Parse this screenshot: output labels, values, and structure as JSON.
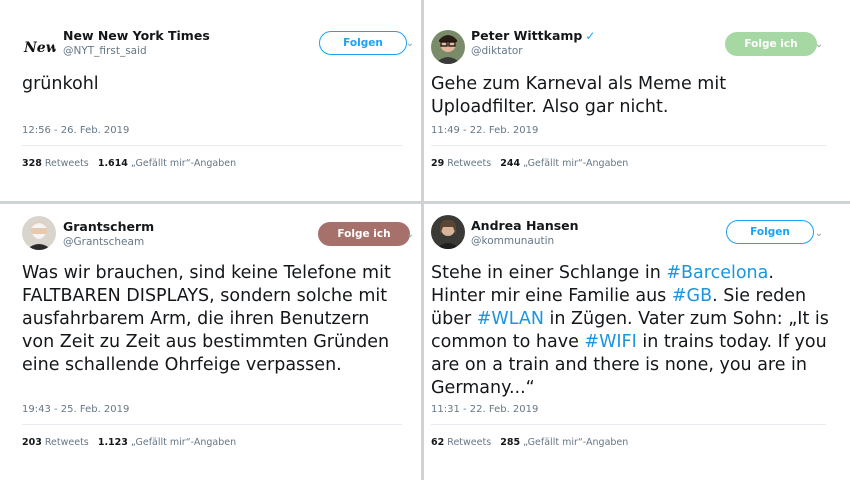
{
  "tweets": [
    {
      "name": "New New York Times",
      "handle": "@NYT_first_said",
      "button": "Folgen",
      "text": "grünkohl",
      "time": "12:56 - 26. Feb. 2019",
      "retweets_count": "328",
      "retweets_label": "Retweets",
      "likes_count": "1.614",
      "likes_label": "„Gefällt mir“-Angaben",
      "avatar_text": "New"
    },
    {
      "name": "Peter Wittkamp",
      "handle": "@diktator",
      "button": "Folge ich",
      "text": "Gehe zum Karneval als Meme mit Uploadfilter. Also gar nicht.",
      "time": "11:49 - 22. Feb. 2019",
      "retweets_count": "29",
      "retweets_label": "Retweets",
      "likes_count": "244",
      "likes_label": "„Gefällt mir“-Angaben"
    },
    {
      "name": "Grantscherm",
      "handle": "@Grantscheam",
      "button": "Folge ich",
      "text": "Was wir brauchen, sind keine Telefone mit FALTBAREN DISPLAYS, sondern solche mit ausfahrbarem Arm, die ihren Benutzern von Zeit zu Zeit aus bestimmten Gründen eine schallende Ohrfeige verpassen.",
      "time": "19:43 - 25. Feb. 2019",
      "retweets_count": "203",
      "retweets_label": "Retweets",
      "likes_count": "1.123",
      "likes_label": "„Gefällt mir“-Angaben"
    },
    {
      "name": "Andrea Hansen",
      "handle": "@kommunautin",
      "button": "Folgen",
      "text_parts": [
        "Stehe in einer Schlange in ",
        "#Barcelona",
        ". Hinter mir eine Familie aus ",
        "#GB",
        ". Sie reden über ",
        "#WLAN",
        " in Zügen. Vater zum Sohn: „It is common to have ",
        "#WIFI",
        " in trains today. If you are on a train and there is none, you are in Germany...“"
      ],
      "time": "11:31 - 22. Feb. 2019",
      "retweets_count": "62",
      "retweets_label": "Retweets",
      "likes_count": "285",
      "likes_label": "„Gefällt mir“-Angaben"
    }
  ],
  "colors": {
    "link": "#1b95e0",
    "follow": "#1da1f2",
    "following_green": "#a6d8a3",
    "following_brown": "#a6716a"
  },
  "icons": {
    "chevron": "chevron-down-icon",
    "verified": "verified-badge-icon"
  }
}
